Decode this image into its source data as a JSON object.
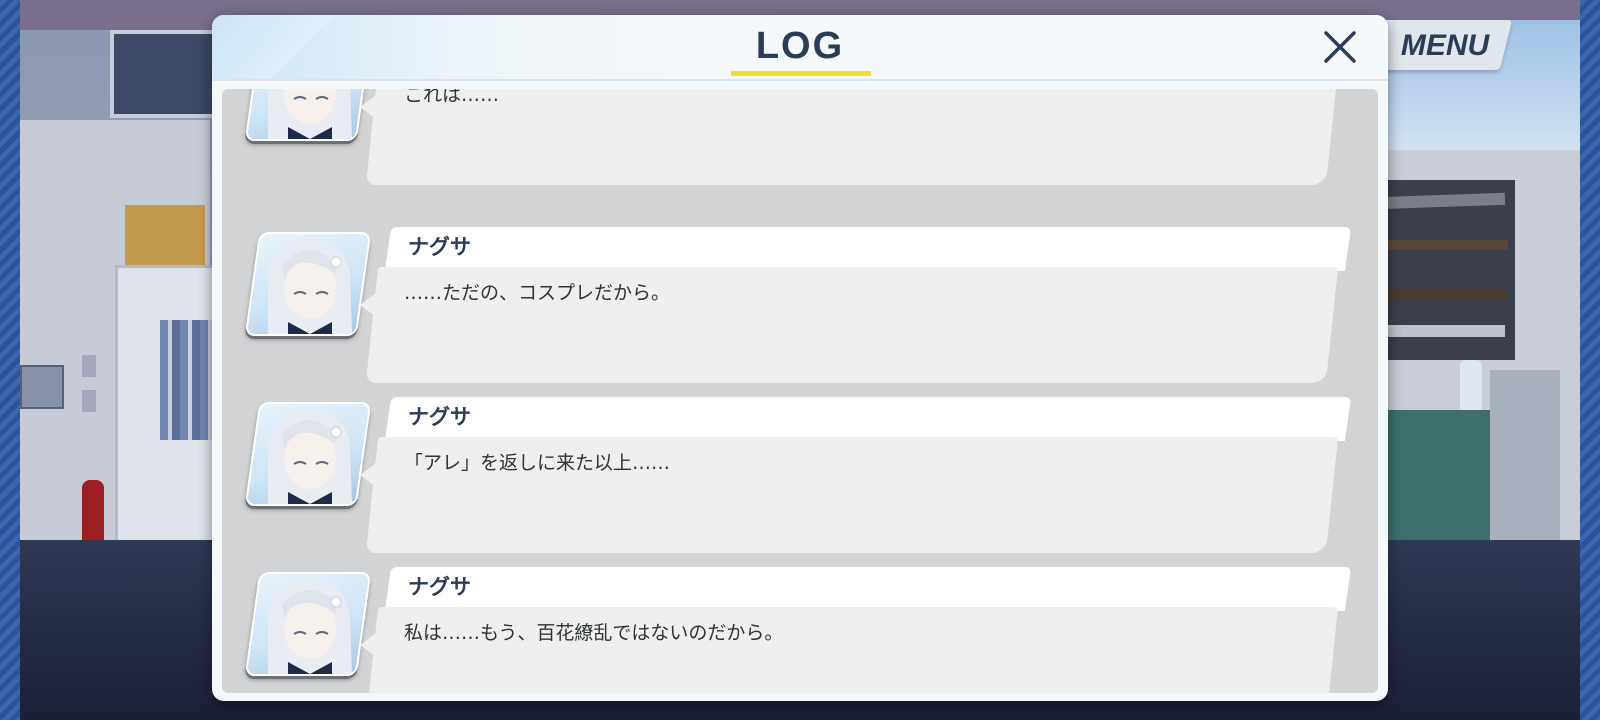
{
  "menu": {
    "label": "MENU"
  },
  "log": {
    "title": "LOG",
    "close_icon": "close-icon",
    "entries": [
      {
        "speaker": "",
        "text": "これは……"
      },
      {
        "speaker": "ナグサ",
        "text": "……ただの、コスプレだから。"
      },
      {
        "speaker": "ナグサ",
        "text": "「アレ」を返しに来た以上……"
      },
      {
        "speaker": "ナグサ",
        "text": "私は……もう、百花繚乱ではないのだから。"
      }
    ]
  },
  "colors": {
    "accent_underline": "#f1df30",
    "title_text": "#2b3c56",
    "bubble": "#efefed",
    "frame_blue": "#3a66b4"
  }
}
